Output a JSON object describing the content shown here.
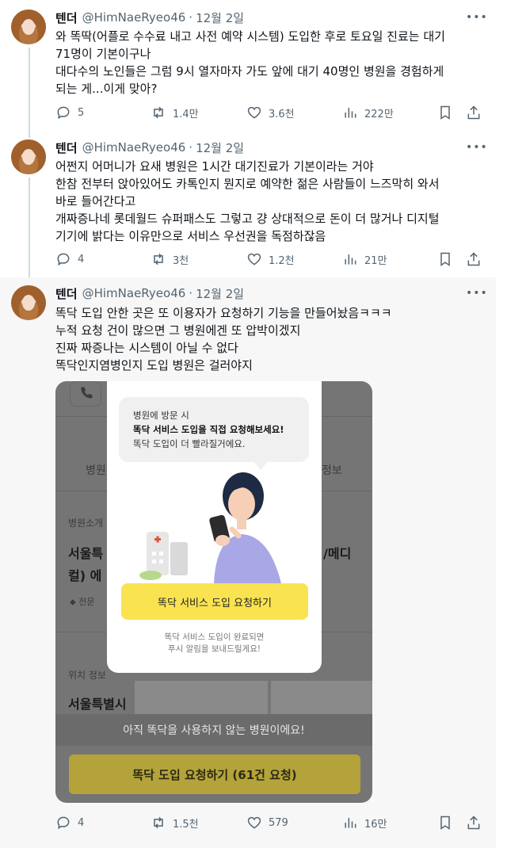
{
  "tweets": [
    {
      "name": "텐더",
      "handle": "@HimNaeRyeo46",
      "separator": "·",
      "date": "12월 2일",
      "lines": [
        "와 똑딱(어플로 수수료 내고 사전 예약 시스템) 도입한 후로 토요일 진료는 대기",
        "71명이 기본이구나",
        "대다수의 노인들은 그럼 9시 열자마자 가도 앞에 대기 40명인 병원을 경험하게",
        "되는 게...이게 맞아?"
      ],
      "replies": "5",
      "retweets": "1.4만",
      "likes": "3.6천",
      "views": "222만"
    },
    {
      "name": "텐더",
      "handle": "@HimNaeRyeo46",
      "separator": "·",
      "date": "12월 2일",
      "lines": [
        "어쩐지 어머니가 요새 병원은 1시간 대기진료가 기본이라는 거야",
        "한참 전부터 앉아있어도 카톡인지 뭔지로 예약한 젊은 사람들이 느즈막히 와서",
        "바로 들어간다고",
        "개짜증나네 롯데월드 슈퍼패스도 그렇고 걍 상대적으로 돈이 더 많거나 디지털",
        "기기에 밝다는 이유만으로 서비스 우선권을 독점하잖음"
      ],
      "replies": "4",
      "retweets": "3천",
      "likes": "1.2천",
      "views": "21만"
    },
    {
      "name": "텐더",
      "handle": "@HimNaeRyeo46",
      "separator": "·",
      "date": "12월 2일",
      "lines": [
        "똑닥 도입 안한 곳은 또 이용자가 요청하기 기능을 만들어놨음ㅋㅋㅋ",
        "누적 요청 건이 많으면 그 병원에겐 또 압박이겠지",
        "진짜 짜증나는 시스템이 아닐 수 없다",
        "똑닥인지염병인지 도입 병원은 걸러야지"
      ],
      "replies": "4",
      "retweets": "1.5천",
      "likes": "579",
      "views": "16만"
    }
  ],
  "embedded": {
    "tab_left": "병원",
    "tab_right": "정보",
    "section_intro": "병원소개",
    "hospital_name_left": "서울특",
    "hospital_name_right": "/메디",
    "hospital_name_line2": "컬) 에",
    "tag_label": "전문",
    "location_label": "위치 정보",
    "location_value": "서울특별시",
    "notice": "아직 똑닥을 사용하지 않는 병원이에요!",
    "request_button": "똑닥 도입 요청하기 (61건 요청)",
    "modal": {
      "line1": "병원에 방문 시",
      "line2": "똑닥 서비스 도입을 직접 요청해보세요!",
      "line3": "똑닥 도입이 더 빨라질거에요.",
      "button": "똑닥 서비스 도입 요청하기",
      "foot1": "똑닥 서비스 도입이 완료되면",
      "foot2": "푸시 알림을 보내드릴게요!"
    }
  },
  "colors": {
    "text_primary": "#0f1419",
    "text_secondary": "#536471",
    "thread_line": "#cfd9de",
    "modal_button": "#fae351"
  },
  "icons": [
    "reply-icon",
    "retweet-icon",
    "like-icon",
    "views-icon",
    "bookmark-icon",
    "share-icon",
    "more-icon"
  ]
}
